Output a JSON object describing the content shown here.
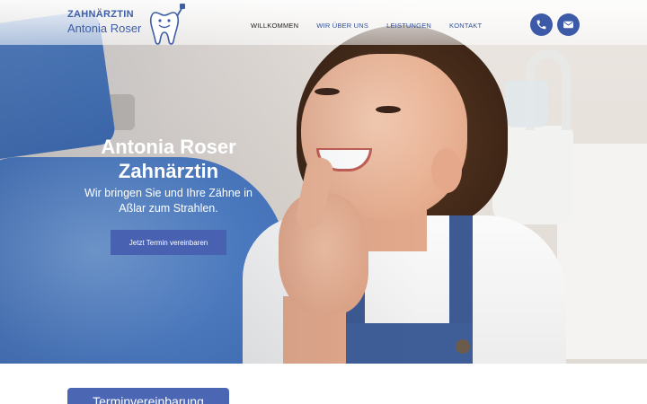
{
  "header": {
    "logo": {
      "line1": "ZAHNÄRZTIN",
      "line2": "Antonia Roser",
      "icon": "tooth-mascot-icon"
    },
    "nav": [
      {
        "label": "WILLKOMMEN",
        "active": true
      },
      {
        "label": "WIR ÜBER UNS",
        "active": false
      },
      {
        "label": "LEISTUNGEN",
        "active": false
      },
      {
        "label": "KONTAKT",
        "active": false
      }
    ],
    "contact_icons": [
      "phone-icon",
      "mail-icon"
    ]
  },
  "hero": {
    "title_line1": "Antonia Roser",
    "title_line2": "Zahnärztin",
    "subtitle_line1": "Wir bringen Sie und Ihre Zähne in",
    "subtitle_line2": "Aßlar zum Strahlen.",
    "cta_label": "Jetzt Termin vereinbaren"
  },
  "appointment": {
    "tab_label": "Terminvereinbarung"
  },
  "colors": {
    "brand_blue": "#3e5ea6",
    "button_blue": "#4861b0",
    "nav_active": "#222222"
  }
}
